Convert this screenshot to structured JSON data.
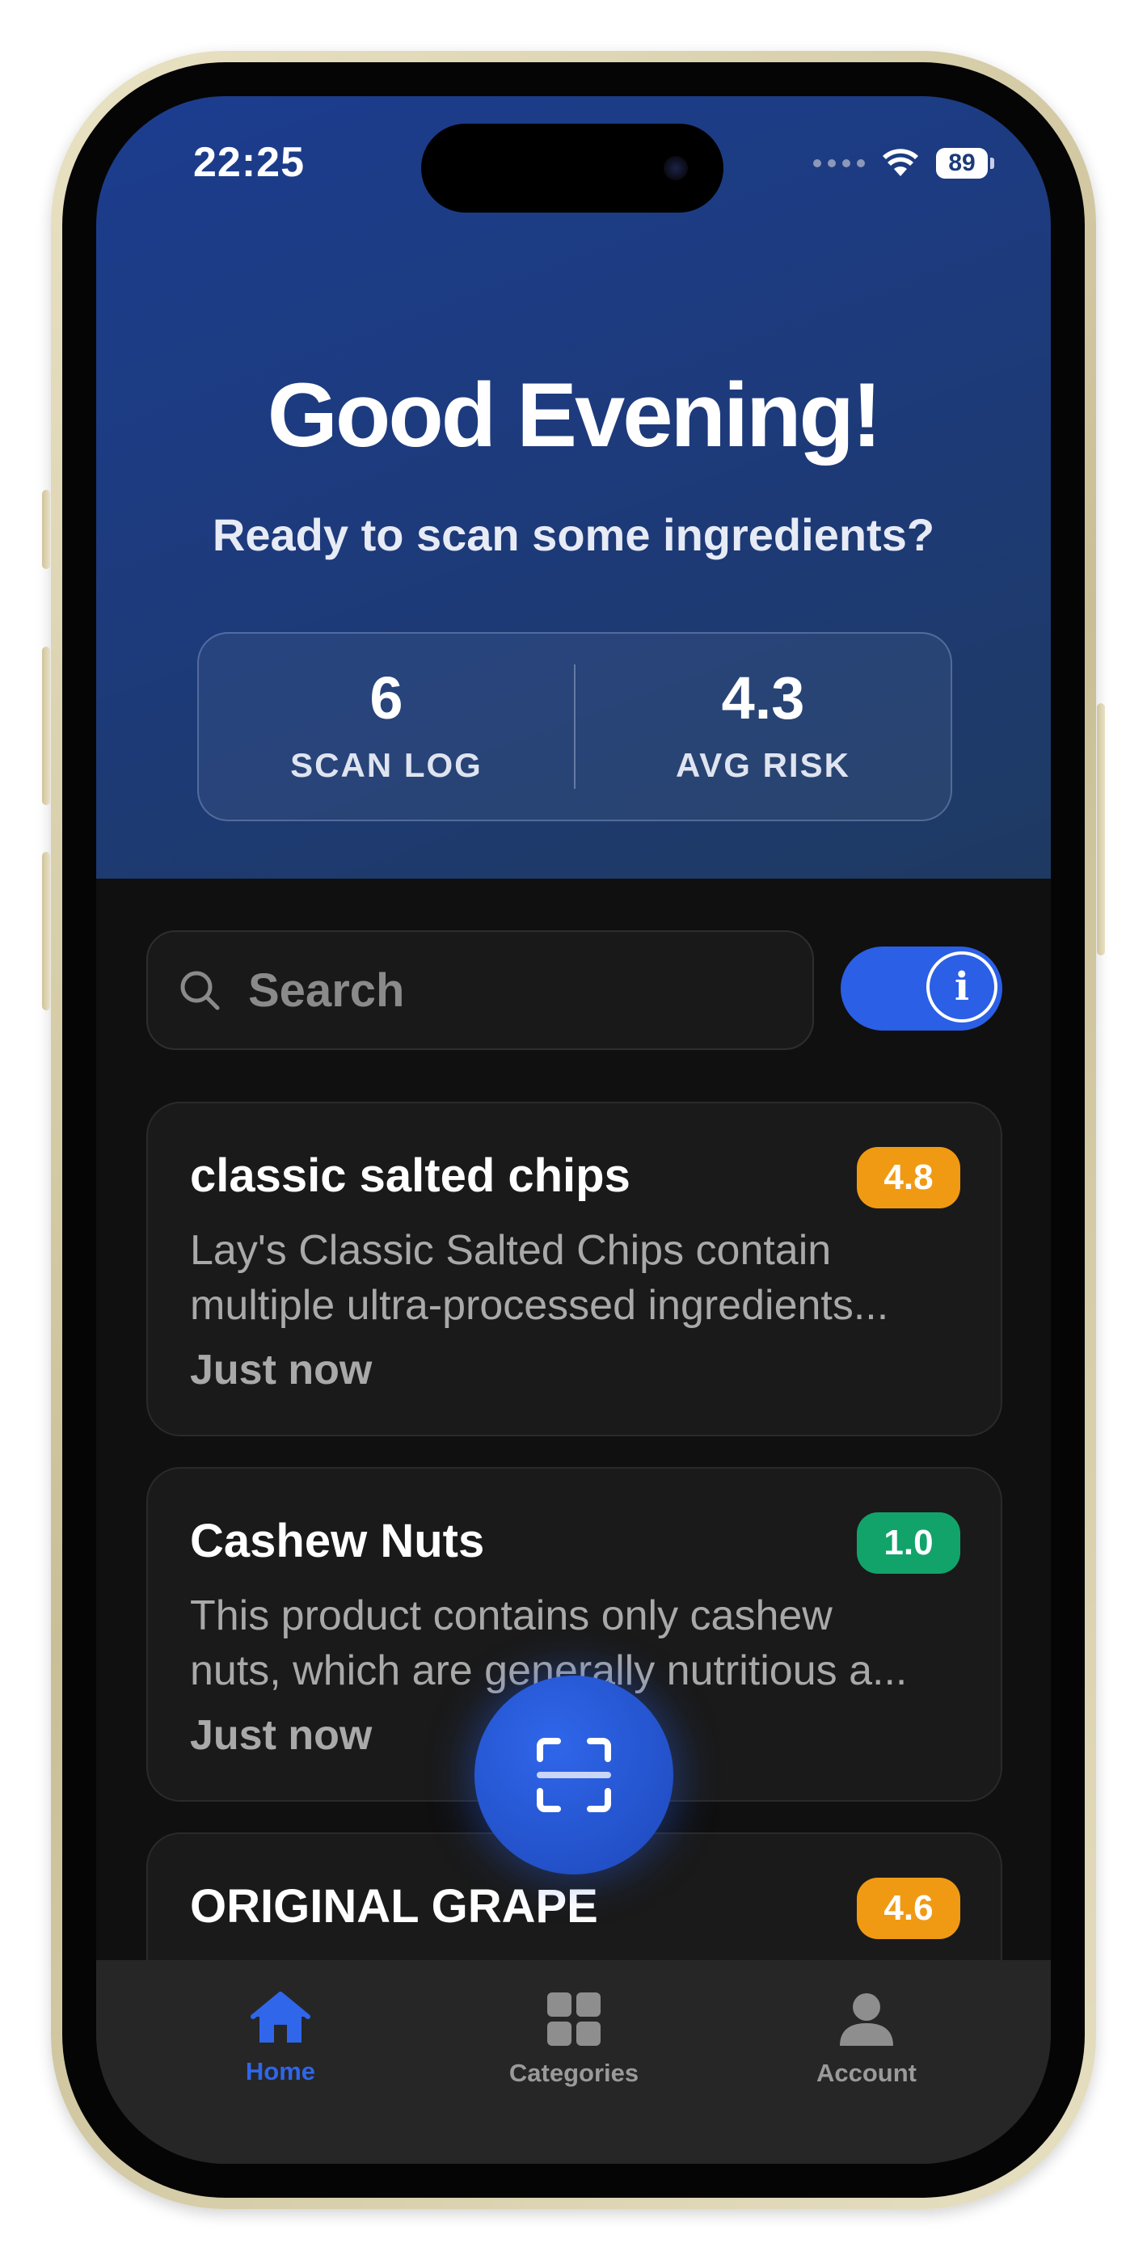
{
  "status_bar": {
    "time": "22:25",
    "battery": "89"
  },
  "header": {
    "greeting": "Good Evening!",
    "subtitle": "Ready to scan some ingredients?",
    "stats": [
      {
        "value": "6",
        "label": "SCAN LOG"
      },
      {
        "value": "4.3",
        "label": "AVG RISK"
      }
    ]
  },
  "search": {
    "placeholder": "Search",
    "value": ""
  },
  "info_toggle": {
    "state": "on",
    "icon": "info-icon"
  },
  "scans": [
    {
      "title": "classic salted chips",
      "score": "4.8",
      "score_color": "#f09a13",
      "desc_line1": "Lay's Classic Salted Chips contain",
      "desc_line2": "multiple ultra-processed ingredients...",
      "time": "Just now"
    },
    {
      "title": "Cashew Nuts",
      "score": "1.0",
      "score_color": "#12a36a",
      "desc_line1": "This product contains only cashew",
      "desc_line2": "nuts, which are generally nutritious a...",
      "time": "Just now"
    },
    {
      "title": "ORIGINAL GRAPE",
      "score": "4.6",
      "score_color": "#f09a13",
      "desc_line1": "",
      "desc_line2": "",
      "time": ""
    }
  ],
  "scan_button": {
    "icon": "scan-icon"
  },
  "tabbar": {
    "items": [
      {
        "label": "Home",
        "icon": "home-icon",
        "active": true
      },
      {
        "label": "Categories",
        "icon": "grid-icon",
        "active": false
      },
      {
        "label": "Account",
        "icon": "person-icon",
        "active": false
      }
    ]
  },
  "colors": {
    "accent": "#2a5fe6",
    "header_bg": "#1d3a78",
    "screen_bg": "#101010",
    "card_bg": "#1a1a1a"
  }
}
